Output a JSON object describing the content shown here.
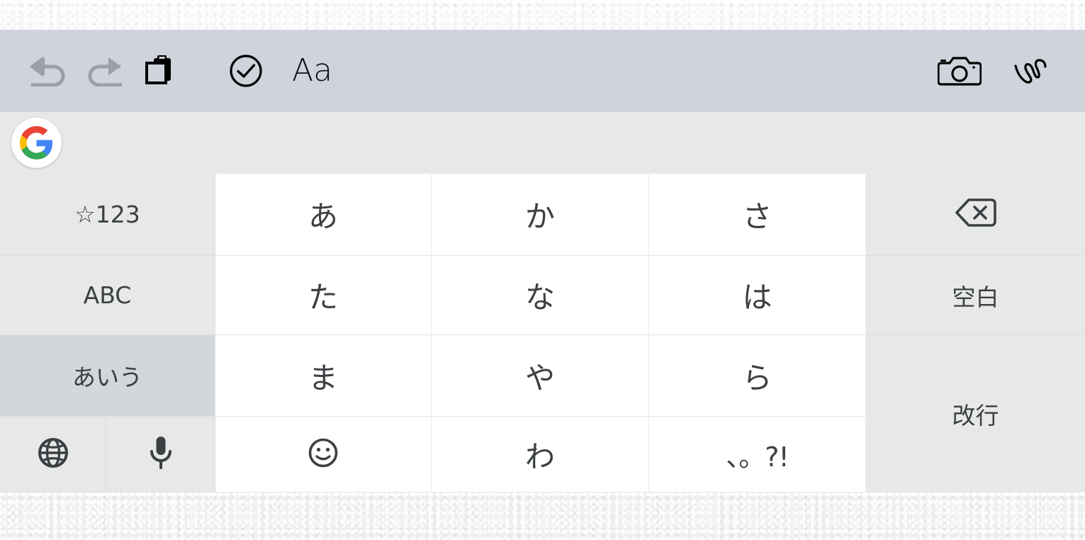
{
  "toolbar": {
    "background_color": "#ced3dc",
    "left_buttons": [
      {
        "name": "undo",
        "icon": "undo-icon",
        "state": "disabled",
        "color": "#9aa0a6"
      },
      {
        "name": "redo",
        "icon": "redo-icon",
        "state": "disabled",
        "color": "#9aa0a6"
      },
      {
        "name": "clipboard",
        "icon": "clipboard-icon",
        "state": "enabled",
        "color": "#000000"
      },
      {
        "name": "check",
        "icon": "check-circle-icon",
        "state": "enabled",
        "color": "#000000"
      },
      {
        "name": "text-format",
        "icon": "text-format-icon",
        "label": "Aa",
        "state": "enabled",
        "color": "#101114"
      }
    ],
    "right_buttons": [
      {
        "name": "camera",
        "icon": "camera-icon",
        "state": "enabled",
        "color": "#000000"
      },
      {
        "name": "handwriting",
        "icon": "scribble-icon",
        "state": "enabled",
        "color": "#000000"
      }
    ]
  },
  "suggestion_bar": {
    "background_color": "#e7e8e8",
    "logo": {
      "name": "google-logo",
      "colors": {
        "red": "#EA4335",
        "yellow": "#FBBC05",
        "green": "#34A853",
        "blue": "#4285F4"
      }
    },
    "suggestions": []
  },
  "keyboard": {
    "background_color": "#e7e8e8",
    "key_background": "#ffffff",
    "function_key_background": "#e7e8e8",
    "active_key_background": "#d4d7da",
    "text_color": "#3c4043",
    "mode_keys": [
      {
        "id": "symbols",
        "label": "☆123",
        "active": false
      },
      {
        "id": "alphabet",
        "label": "ABC",
        "active": false
      },
      {
        "id": "kana",
        "label": "あいう",
        "active": true
      }
    ],
    "bottom_left_keys": [
      {
        "id": "language-switch",
        "icon": "globe-icon"
      },
      {
        "id": "voice-input",
        "icon": "microphone-icon"
      }
    ],
    "kana_grid": [
      [
        {
          "id": "a-row",
          "label": "あ",
          "type": "text"
        },
        {
          "id": "ka-row",
          "label": "か",
          "type": "text"
        },
        {
          "id": "sa-row",
          "label": "さ",
          "type": "text"
        }
      ],
      [
        {
          "id": "ta-row",
          "label": "た",
          "type": "text"
        },
        {
          "id": "na-row",
          "label": "な",
          "type": "text"
        },
        {
          "id": "ha-row",
          "label": "は",
          "type": "text"
        }
      ],
      [
        {
          "id": "ma-row",
          "label": "ま",
          "type": "text"
        },
        {
          "id": "ya-row",
          "label": "や",
          "type": "text"
        },
        {
          "id": "ra-row",
          "label": "ら",
          "type": "text"
        }
      ],
      [
        {
          "id": "emoji",
          "label": "",
          "type": "icon",
          "icon": "smiley-icon"
        },
        {
          "id": "wa-row",
          "label": "わ",
          "type": "text"
        },
        {
          "id": "punctuation",
          "label": "、。?!",
          "type": "punct"
        }
      ]
    ],
    "right_keys": [
      {
        "id": "backspace",
        "label": "",
        "type": "icon",
        "icon": "backspace-icon"
      },
      {
        "id": "space",
        "label": "空白",
        "type": "text"
      },
      {
        "id": "enter",
        "label": "改行",
        "type": "text"
      }
    ]
  }
}
